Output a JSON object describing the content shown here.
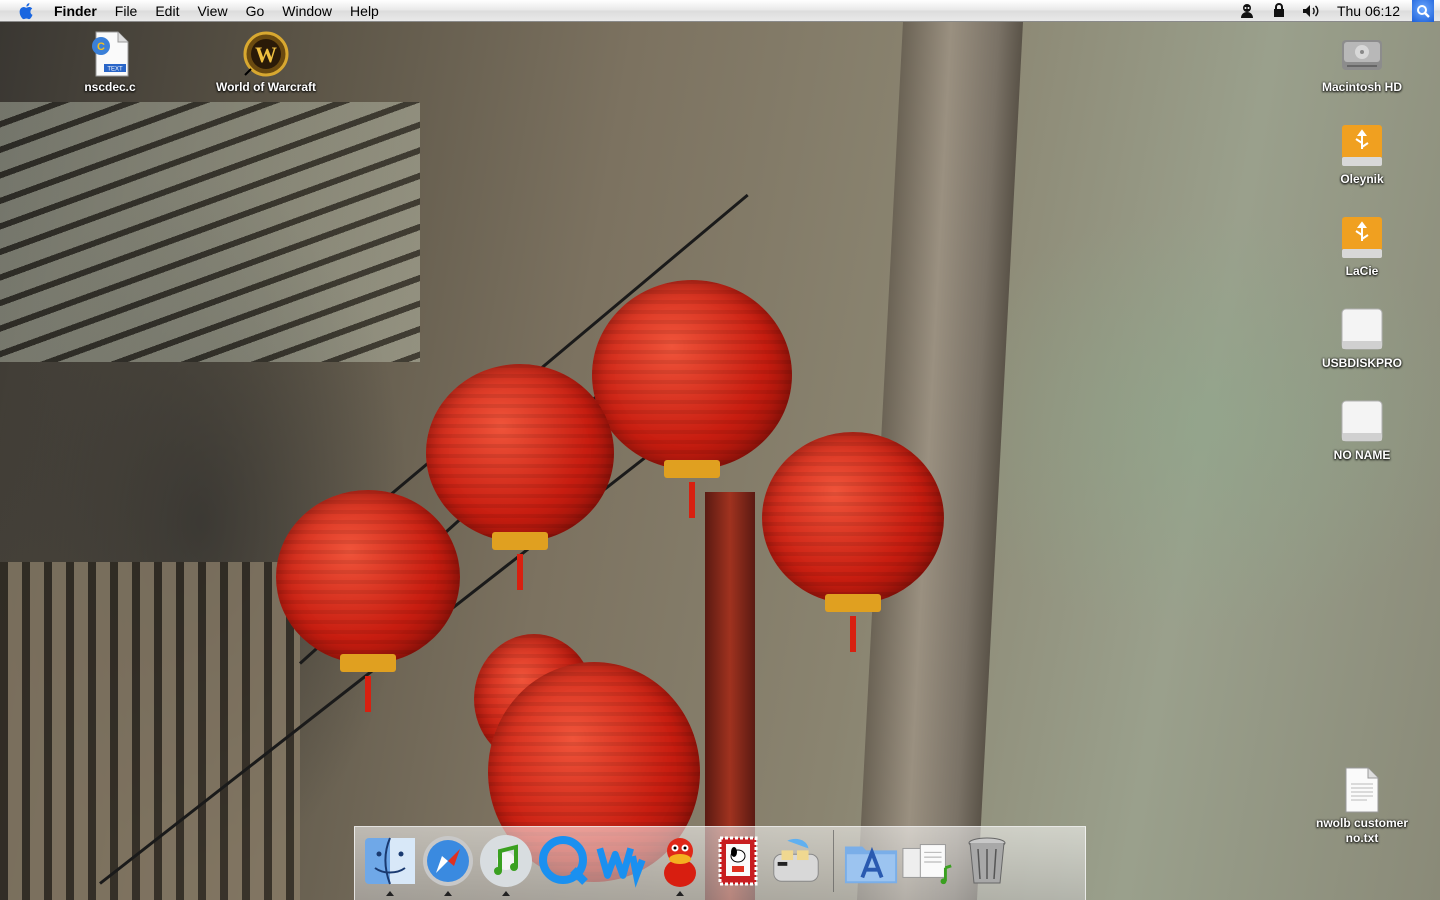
{
  "menubar": {
    "apple_icon": "apple-logo-icon",
    "app_name": "Finder",
    "menus": [
      "File",
      "Edit",
      "View",
      "Go",
      "Window",
      "Help"
    ],
    "status_icons": [
      "user-account-icon",
      "lock-icon",
      "volume-icon"
    ],
    "clock": "Thu 06:12",
    "spotlight_icon": "spotlight-icon"
  },
  "desktop": {
    "icons_left": [
      {
        "label": "nscdec.c",
        "icon": "text-file-icon"
      },
      {
        "label": "World of Warcraft",
        "icon": "warcraft-alias-icon"
      }
    ],
    "icons_right": [
      {
        "label": "Macintosh HD",
        "icon": "hard-drive-icon"
      },
      {
        "label": "Oleynik",
        "icon": "usb-drive-icon"
      },
      {
        "label": "LaCie",
        "icon": "usb-drive-icon"
      },
      {
        "label": "USBDISKPRO",
        "icon": "removable-disk-icon"
      },
      {
        "label": "NO NAME",
        "icon": "removable-disk-icon"
      },
      {
        "label": "nwolb customer no.txt",
        "icon": "text-document-icon"
      }
    ]
  },
  "dock": {
    "apps": [
      {
        "name": "Finder",
        "icon": "finder-icon",
        "running": true
      },
      {
        "name": "Safari",
        "icon": "safari-icon",
        "running": true
      },
      {
        "name": "iTunes",
        "icon": "itunes-icon",
        "running": true
      },
      {
        "name": "QuickTime",
        "icon": "quicktime-icon",
        "running": false
      },
      {
        "name": "Ww",
        "icon": "ww-app-icon",
        "running": false
      },
      {
        "name": "Adium",
        "icon": "adium-duck-icon",
        "running": true
      },
      {
        "name": "Snoopy Stamp",
        "icon": "stamp-app-icon",
        "running": false
      },
      {
        "name": "Toast",
        "icon": "toaster-icon",
        "running": false
      }
    ],
    "docs": [
      {
        "name": "Applications",
        "icon": "applications-folder-icon"
      },
      {
        "name": "Documents",
        "icon": "documents-stack-icon"
      },
      {
        "name": "Trash",
        "icon": "trash-icon"
      }
    ]
  },
  "colors": {
    "menubar_bg": "#e9e9e9",
    "spotlight": "#1c5fd8",
    "lantern_red": "#c81d10",
    "usb_orange": "#f0a020"
  }
}
